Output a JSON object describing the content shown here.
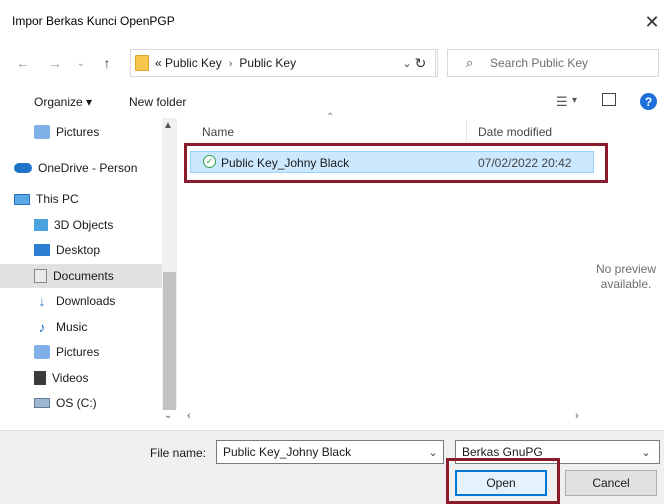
{
  "window": {
    "title": "Impor Berkas Kunci OpenPGP"
  },
  "nav": {
    "breadcrumb_overflow": "«",
    "crumbs": [
      "Public Key",
      "Public Key"
    ],
    "search_placeholder": "Search Public Key"
  },
  "toolbar": {
    "organize_label": "Organize ▾",
    "new_folder_label": "New folder"
  },
  "sidebar": {
    "items": [
      {
        "label": "Pictures",
        "icon": "pictures-icon"
      },
      {
        "label": "OneDrive - Person",
        "icon": "onedrive-icon"
      },
      {
        "label": "This PC",
        "icon": "computer-icon"
      },
      {
        "label": "3D Objects",
        "icon": "3d-objects-icon"
      },
      {
        "label": "Desktop",
        "icon": "desktop-icon"
      },
      {
        "label": "Documents",
        "icon": "documents-icon",
        "active": true
      },
      {
        "label": "Downloads",
        "icon": "downloads-icon"
      },
      {
        "label": "Music",
        "icon": "music-icon"
      },
      {
        "label": "Pictures",
        "icon": "pictures-icon"
      },
      {
        "label": "Videos",
        "icon": "videos-icon"
      },
      {
        "label": "OS (C:)",
        "icon": "drive-icon"
      }
    ]
  },
  "filelist": {
    "columns": {
      "name": "Name",
      "date": "Date modified"
    },
    "rows": [
      {
        "name": "Public Key_Johny Black",
        "date": "07/02/2022 20:42",
        "selected": true
      }
    ]
  },
  "preview": {
    "text_line1": "No preview",
    "text_line2": "available."
  },
  "footer": {
    "filename_label": "File name:",
    "filename_value": "Public Key_Johny Black",
    "filter_value": "Berkas GnuPG",
    "open_label": "Open",
    "cancel_label": "Cancel"
  },
  "colors": {
    "highlight_box": "#8b1a2b",
    "selection": "#cce8ff",
    "accent": "#0078d7"
  }
}
